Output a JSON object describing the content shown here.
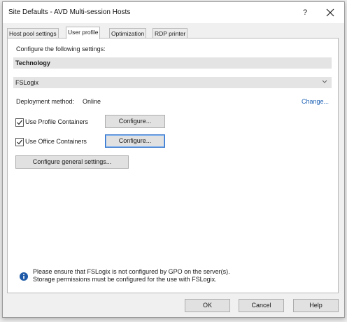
{
  "window": {
    "title": "Site Defaults - AVD Multi-session Hosts",
    "help_label": "?"
  },
  "tabs": [
    {
      "label": "Host pool settings"
    },
    {
      "label": "User profile"
    },
    {
      "label": "Optimization"
    },
    {
      "label": "RDP printer"
    }
  ],
  "active_tab": "User profile",
  "panel": {
    "intro": "Configure the following settings:",
    "section_title": "Technology",
    "technology_select": {
      "value": "FSLogix"
    },
    "deployment": {
      "label": "Deployment method:",
      "value": "Online",
      "change_link": "Change..."
    },
    "profile_containers": {
      "label": "Use Profile Containers",
      "checked": true,
      "configure_label": "Configure..."
    },
    "office_containers": {
      "label": "Use Office Containers",
      "checked": true,
      "configure_label": "Configure..."
    },
    "general_settings_label": "Configure general settings...",
    "notice": {
      "icon": "info-icon",
      "line1": "Please ensure that FSLogix is not configured by GPO on the server(s).",
      "line2": "Storage permissions must be configured for the use with FSLogix."
    }
  },
  "footer": {
    "ok_label": "OK",
    "cancel_label": "Cancel",
    "help_label": "Help"
  },
  "colors": {
    "link": "#1a5fb4",
    "info_icon": "#1e5aa8",
    "focus_border": "#2a6cc7"
  }
}
